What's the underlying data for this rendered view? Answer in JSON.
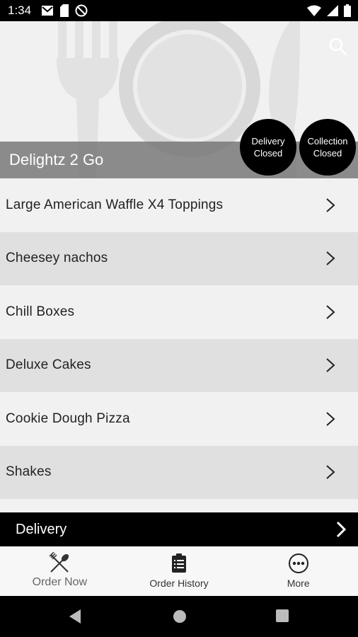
{
  "status_bar": {
    "time": "1:34",
    "left_icons": [
      "gmail-icon",
      "sim-icon",
      "no-disturb-icon"
    ],
    "right_icons": [
      "wifi-icon",
      "signal-icon",
      "battery-icon"
    ]
  },
  "header": {
    "restaurant_name": "Delightz 2 Go",
    "search_icon": "search-icon",
    "delivery_status": {
      "line1": "Delivery",
      "line2": "Closed"
    },
    "collection_status": {
      "line1": "Collection",
      "line2": "Closed"
    }
  },
  "menu": {
    "categories": [
      {
        "label": "Large American Waffle X4 Toppings"
      },
      {
        "label": "Cheesey nachos"
      },
      {
        "label": "Chill Boxes"
      },
      {
        "label": "Deluxe Cakes"
      },
      {
        "label": "Cookie Dough Pizza"
      },
      {
        "label": "Shakes"
      }
    ]
  },
  "delivery_bar": {
    "label": "Delivery"
  },
  "tabs": [
    {
      "label": "Order Now",
      "icon": "cutlery-icon",
      "active": true
    },
    {
      "label": "Order History",
      "icon": "clipboard-icon",
      "active": false
    },
    {
      "label": "More",
      "icon": "more-icon",
      "active": false
    }
  ],
  "nav_bar": {
    "buttons": [
      "back-icon",
      "home-icon",
      "recents-icon"
    ]
  },
  "colors": {
    "accent": "#000000",
    "list_odd": "#f1f1f1",
    "list_even": "#e0e0e0",
    "band": "#6e6e6e"
  }
}
